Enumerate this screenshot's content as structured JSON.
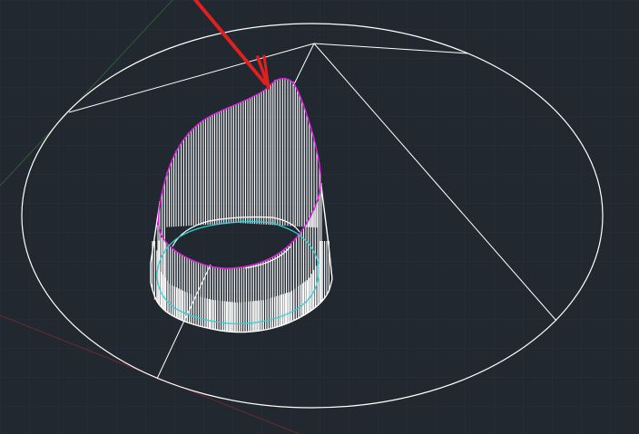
{
  "viewport": {
    "background": "#212830",
    "grid_color": "#2a313a",
    "axis_x_color": "#6b2a30",
    "axis_y_color": "#2f5a34"
  },
  "drawing": {
    "wire_color": "#ffffff",
    "top_profile_color": "#e020e0",
    "bottom_profile_color": "#30d0d8",
    "arrow_color": "#e02020",
    "arrow_icon": "red-pointer-arrow-icon"
  }
}
